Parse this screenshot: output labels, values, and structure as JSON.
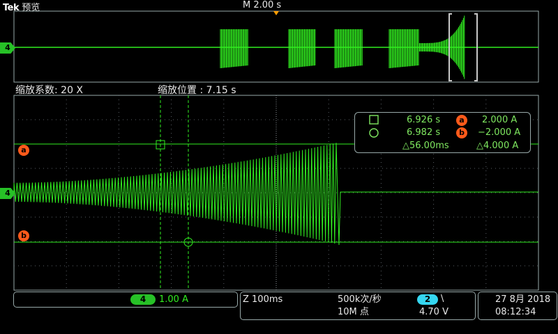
{
  "header": {
    "brand": "Tek",
    "mode": "预览",
    "timebase": "M 2.00 s"
  },
  "zoom": {
    "factor": "缩放系数: 20 X",
    "position": "缩放位置 : 7.15 s"
  },
  "channel_marker": "4",
  "cursor_labels": {
    "a": "a",
    "b": "b"
  },
  "cursor_readout": {
    "cursor1_time": "6.926 s",
    "cursor2_time": "6.982 s",
    "delta_time": "△56.00ms",
    "cursor_a_value": "2.000 A",
    "cursor_b_value": "−2.000 A",
    "delta_value": "△4.000 A"
  },
  "channel_panel": {
    "channel": "4",
    "scale": "1.00 A"
  },
  "acquisition_panel": {
    "zoom_timebase": "Z 100ms",
    "sample_rate": "500k次/秒",
    "record_length": "10M 点",
    "trigger_source": "2",
    "trigger_slope": "\\",
    "trigger_level": "4.70 V"
  },
  "datetime": {
    "date": "27 8月 2018",
    "time": "08:12:34"
  },
  "colors": {
    "trace": "#31ee20",
    "grid": "#5a5f66",
    "cursor_marker": "#ff5a1a",
    "trigger": "#ff9d00",
    "cursor_readout_text": "#7fe860"
  }
}
